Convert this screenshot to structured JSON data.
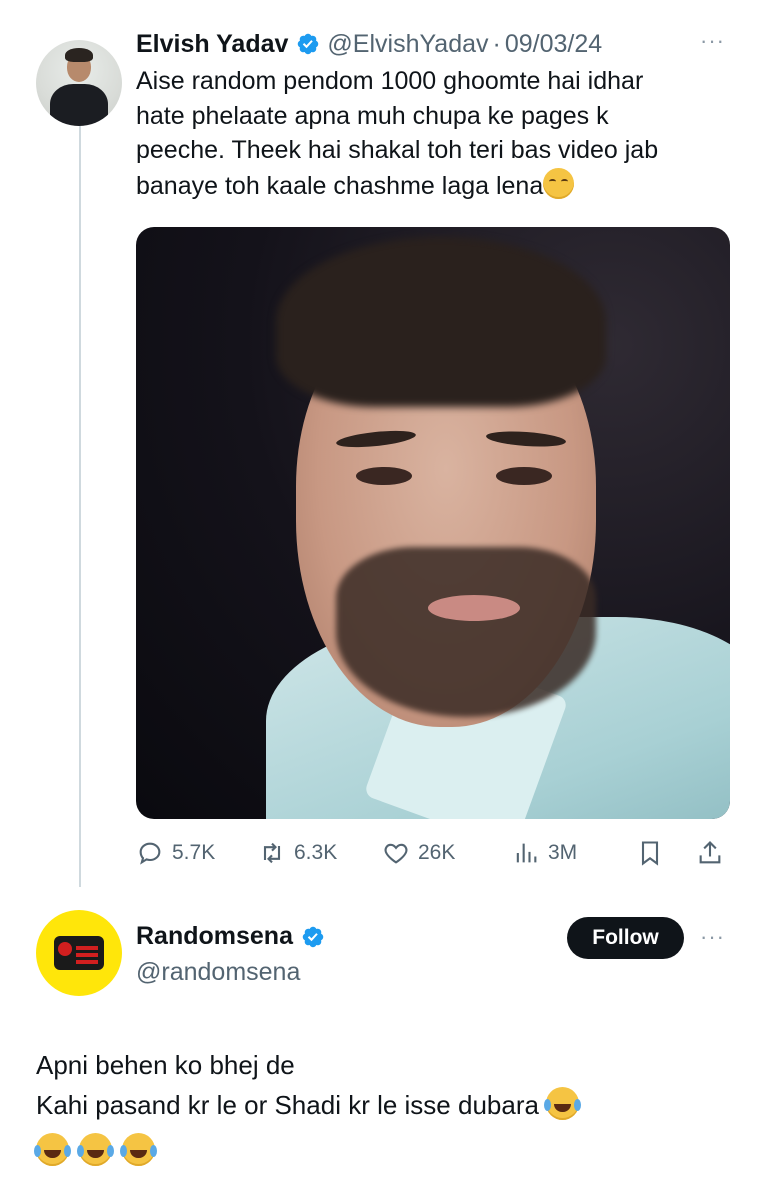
{
  "tweet": {
    "author_name": "Elvish Yadav",
    "handle": "@ElvishYadav",
    "separator": "·",
    "date": "09/03/24",
    "more_label": "···",
    "text": "Aise random pendom 1000 ghoomte hai idhar\nhate phelaate apna muh chupa ke pages k\npeeche. Theek hai shakal toh teri bas video jab\nbanaye toh kaale chashme laga lena",
    "stats": {
      "replies": "5.7K",
      "retweets": "6.3K",
      "likes": "26K",
      "views": "3M"
    }
  },
  "reply_user": {
    "name": "Randomsena",
    "handle": "@randomsena",
    "follow_label": "Follow",
    "more_label": "···",
    "text_line1": "Apni behen ko bhej de",
    "text_line2": "Kahi pasand kr le or Shadi kr le isse dubara"
  },
  "colors": {
    "verified_blue": "#1d9bf0",
    "text_primary": "#0f1419",
    "text_secondary": "#536471",
    "thread_line": "#cfd9de"
  },
  "icons": {
    "verified": "verified-badge-icon",
    "relieved_emoji": "relieved-face-emoji",
    "laugh_emoji": "tears-of-joy-emoji",
    "reply": "reply-icon",
    "retweet": "retweet-icon",
    "like": "heart-icon",
    "views": "views-icon",
    "bookmark": "bookmark-icon",
    "share": "share-icon"
  }
}
